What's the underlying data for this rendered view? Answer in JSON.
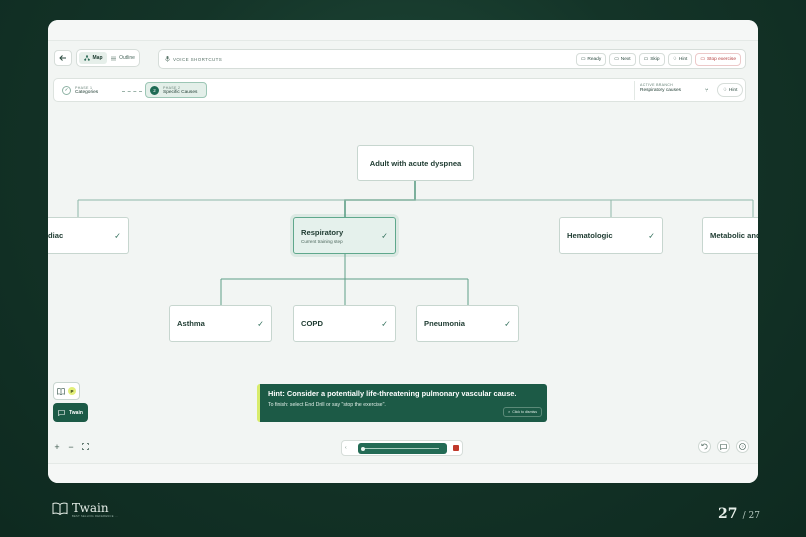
{
  "toolbar": {
    "view_options": [
      "Map",
      "Outline"
    ],
    "voice_label": "VOICE SHORTCUTS",
    "actions": [
      {
        "label": "Ready",
        "icon": "chat-icon"
      },
      {
        "label": "Next",
        "icon": "chat-icon"
      },
      {
        "label": "Skip",
        "icon": "chat-icon"
      },
      {
        "label": "Hint",
        "icon": "bulb-icon"
      },
      {
        "label": "Stop exercise",
        "icon": "chat-icon"
      }
    ]
  },
  "phases": [
    {
      "small": "PHASE 1",
      "label": "Categories",
      "marker": "✓"
    },
    {
      "small": "PHASE 2",
      "label": "Specific Causes",
      "marker": "2"
    }
  ],
  "active_branch": {
    "small": "ACTIVE BRANCH",
    "label": "Respiratory causes",
    "hint": "Hint"
  },
  "tree": {
    "root": "Adult with acute dyspnea",
    "categories": [
      {
        "label": "Cardiac",
        "shown": "diac",
        "check": "✓"
      },
      {
        "label": "Respiratory",
        "sub": "Current training step",
        "check": "✓"
      },
      {
        "label": "Hematologic",
        "check": "✓"
      },
      {
        "label": "Metabolic and",
        "check": ""
      }
    ],
    "children": [
      {
        "label": "Asthma",
        "check": "✓"
      },
      {
        "label": "COPD",
        "check": "✓"
      },
      {
        "label": "Pneumonia",
        "check": "✓"
      }
    ]
  },
  "tools": {
    "badge": "P",
    "twain_label": "Twain"
  },
  "hint_toast": {
    "title": "Hint: Consider a potentially life-threatening pulmonary vascular cause.",
    "subtitle": "To finish: select End Drill or say \"stop the exercise\".",
    "dismiss": "Click to dismiss"
  },
  "footer": {
    "brand": "Twain",
    "tagline": "BEST SELLING REFERENCE ...",
    "page_current": "27",
    "page_total": "/ 27"
  },
  "colors": {
    "accent": "#1c5a46",
    "highlight": "#d8ec6c",
    "stop": "#c0392b"
  }
}
